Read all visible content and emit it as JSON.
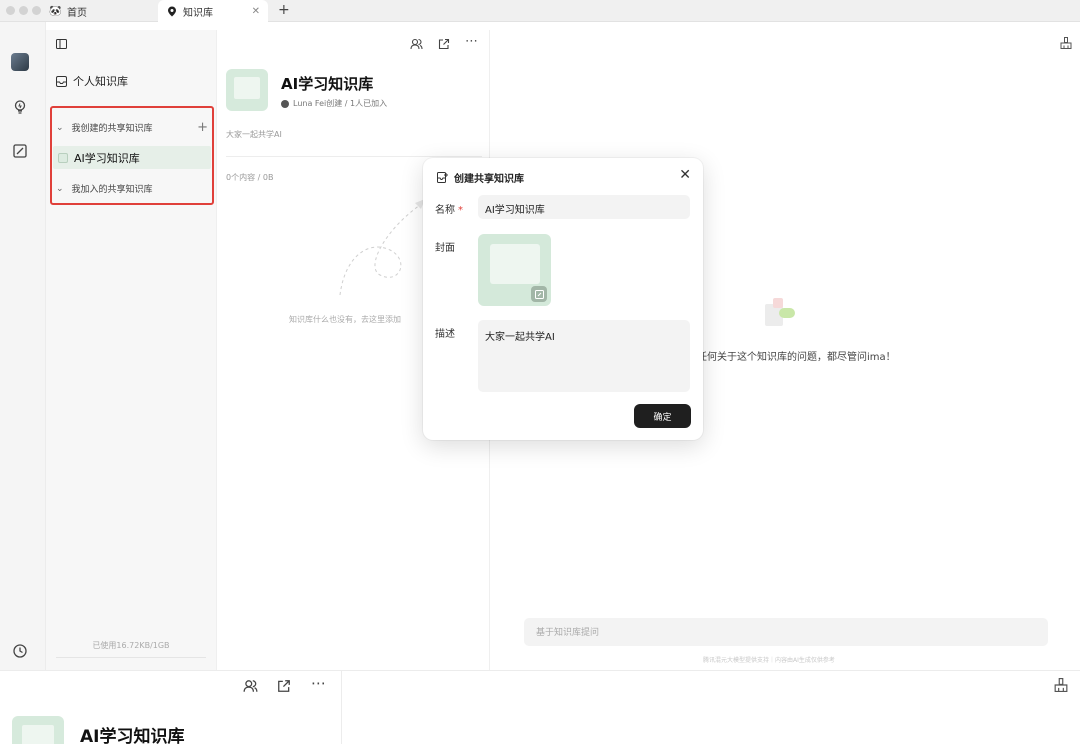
{
  "tabs": [
    {
      "label": "首页",
      "icon": "panda-icon"
    },
    {
      "label": "知识库",
      "icon": "location-pin-icon"
    }
  ],
  "sidebar": {
    "personal_label": "个人知识库",
    "group_created": "我创建的共享知识库",
    "group_joined": "我加入的共享知识库",
    "active_item": "AI学习知识库",
    "usage": "已使用16.72KB/1GB"
  },
  "kb": {
    "title": "AI学习知识库",
    "meta": "Luna Fei创建 / 1人已加入",
    "description": "大家一起共学AI",
    "count": "0个内容 / 0B",
    "empty_tip": "知识库什么也没有，去这里添加"
  },
  "right": {
    "prompt_text": "任何关于这个知识库的问题，都尽管问ima！",
    "ask_placeholder": "基于知识库提问",
    "disclaimer": "腾讯混元大模型提供支持｜内容由AI生成仅供参考"
  },
  "modal": {
    "title": "创建共享知识库",
    "name_label": "名称",
    "required_mark": "*",
    "name_value": "AI学习知识库",
    "cover_label": "封面",
    "desc_label": "描述",
    "desc_value": "大家一起共学AI",
    "confirm_label": "确定"
  },
  "bottom": {
    "title": "AI学习知识库"
  },
  "colors": {
    "accent_green": "#d6eadc",
    "highlight_red": "#e0403a",
    "confirm_bg": "#1f1f1f"
  }
}
